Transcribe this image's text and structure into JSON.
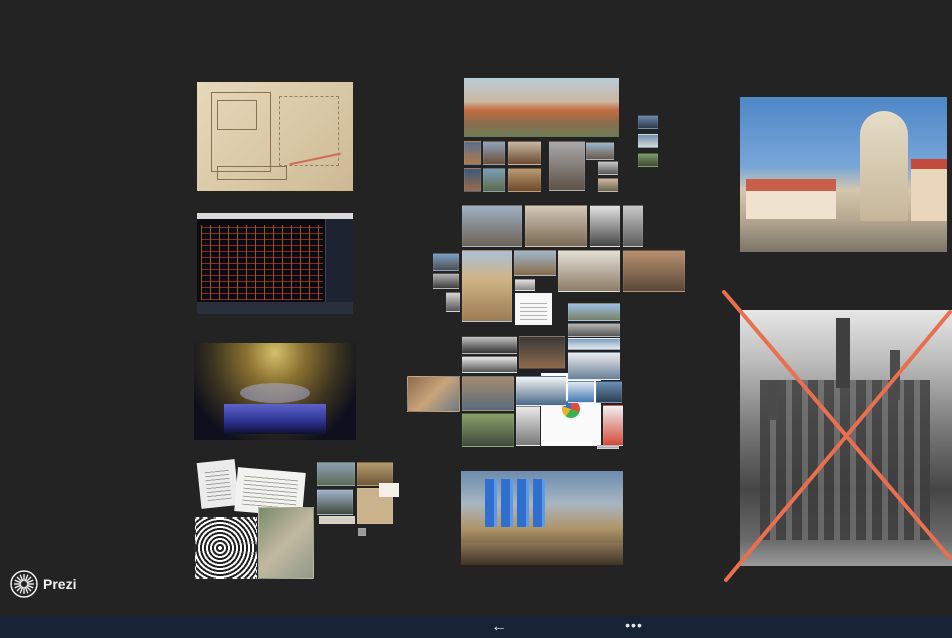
{
  "app": {
    "logo_text": "Prezi"
  },
  "colors": {
    "canvas": "#232323",
    "taskbar": "#172234",
    "cross_mark": "#e8704f"
  },
  "icons": {
    "logo": "prezi-logo-icon",
    "back": "back-arrow-icon",
    "more": "more-dots-icon"
  },
  "taskbar": {
    "back_glyph": "←",
    "more_glyph": "•••"
  }
}
